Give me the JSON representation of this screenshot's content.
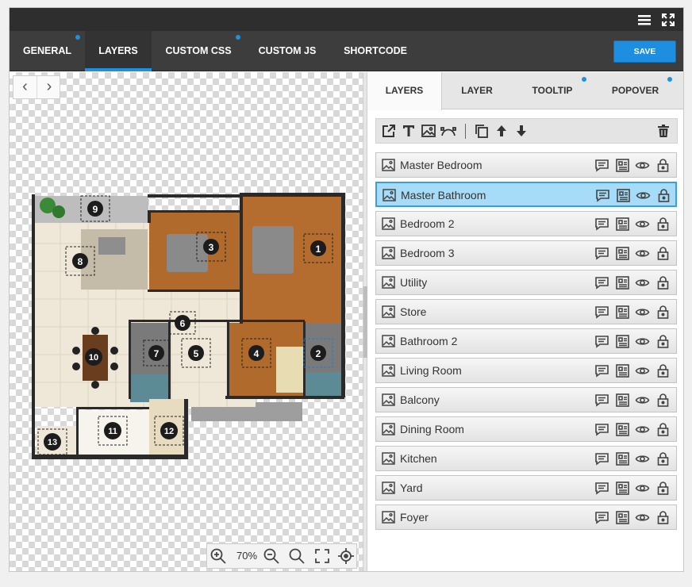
{
  "main_tabs": [
    {
      "label": "GENERAL",
      "dot": true
    },
    {
      "label": "LAYERS",
      "dot": false,
      "active": true
    },
    {
      "label": "CUSTOM CSS",
      "dot": true
    },
    {
      "label": "CUSTOM JS",
      "dot": false
    },
    {
      "label": "SHORTCODE",
      "dot": false
    }
  ],
  "save_label": "SAVE",
  "zoom": "70%",
  "sub_tabs": [
    {
      "label": "LAYERS",
      "active": true
    },
    {
      "label": "LAYER"
    },
    {
      "label": "TOOLTIP",
      "dot": true
    },
    {
      "label": "POPOVER",
      "dot": true
    }
  ],
  "layers": [
    "Master Bedroom",
    "Master Bathroom",
    "Bedroom 2",
    "Bedroom 3",
    "Utility",
    "Store",
    "Bathroom 2",
    "Living Room",
    "Balcony",
    "Dining Room",
    "Kitchen",
    "Yard",
    "Foyer"
  ],
  "selected_layer": "Master Bathroom",
  "floor_labels": [
    "1",
    "2",
    "3",
    "4",
    "5",
    "6",
    "7",
    "8",
    "9",
    "10",
    "11",
    "12",
    "13"
  ],
  "colors": {
    "accent": "#1e90e0",
    "selected_row": "#a6dcf8",
    "topbar": "#2e2e2e",
    "tabbar": "#3d3d3d"
  }
}
